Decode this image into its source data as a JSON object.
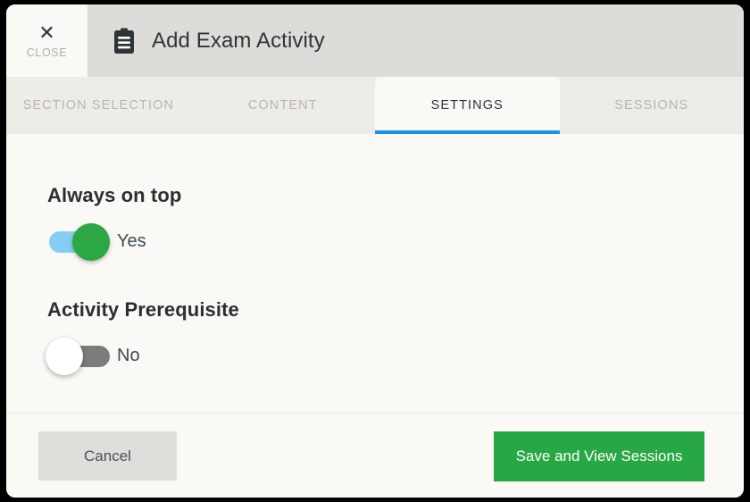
{
  "window": {
    "close_button": {
      "label": "CLOSE",
      "icon": "close-x-icon"
    },
    "title": "Add Exam Activity",
    "title_icon": "clipboard-icon"
  },
  "tabs": [
    {
      "label": "SECTION SELECTION",
      "active": false
    },
    {
      "label": "CONTENT",
      "active": false
    },
    {
      "label": "SETTINGS",
      "active": true
    },
    {
      "label": "SESSIONS",
      "active": false
    }
  ],
  "settings": {
    "fields": [
      {
        "label": "Always on top",
        "value": "Yes",
        "state": "on"
      },
      {
        "label": "Activity Prerequisite",
        "value": "No",
        "state": "off"
      }
    ]
  },
  "footer": {
    "cancel_label": "Cancel",
    "save_label": "Save and View Sessions"
  },
  "colors": {
    "accent_blue": "#1e90e8",
    "toggle_on_track": "#85cdf2",
    "toggle_on_knob": "#2ca744",
    "toggle_off_track": "#7c7c7c",
    "save_green": "#28a745",
    "header_gray": "#dedcd9",
    "tabbar_gray": "#edece8",
    "body_cream": "#faf9f5"
  }
}
